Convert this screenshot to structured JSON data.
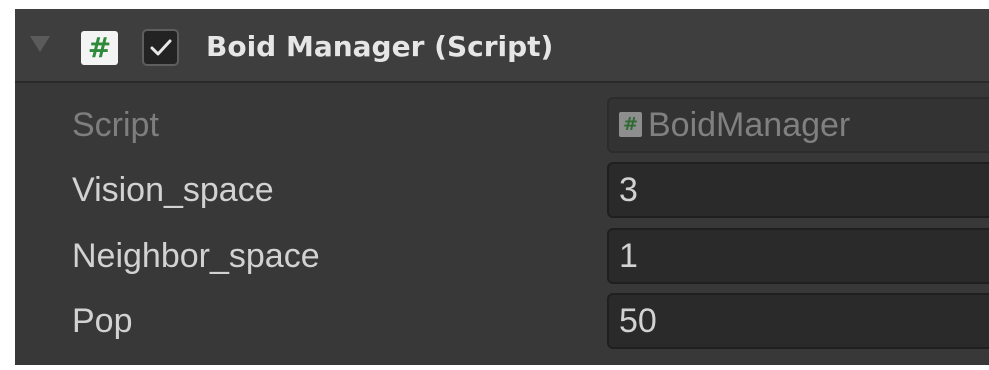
{
  "component": {
    "title": "Boid Manager (Script)",
    "enabled": true,
    "icon": "csharp-script-icon",
    "icon_glyph": "#"
  },
  "properties": [
    {
      "label": "Script",
      "value": "BoidManager",
      "readonly": true,
      "icon_glyph": "#"
    },
    {
      "label": "Vision_space",
      "value": "3",
      "readonly": false
    },
    {
      "label": "Neighbor_space",
      "value": "1",
      "readonly": false
    },
    {
      "label": "Pop",
      "value": "50",
      "readonly": false
    }
  ],
  "colors": {
    "panel_bg": "#383838",
    "header_bg": "#3e3e3e",
    "field_bg": "#2a2a2a",
    "text": "#d2d2d2",
    "disabled_text": "#7e7e7e",
    "script_icon_green": "#2f8a3b"
  }
}
